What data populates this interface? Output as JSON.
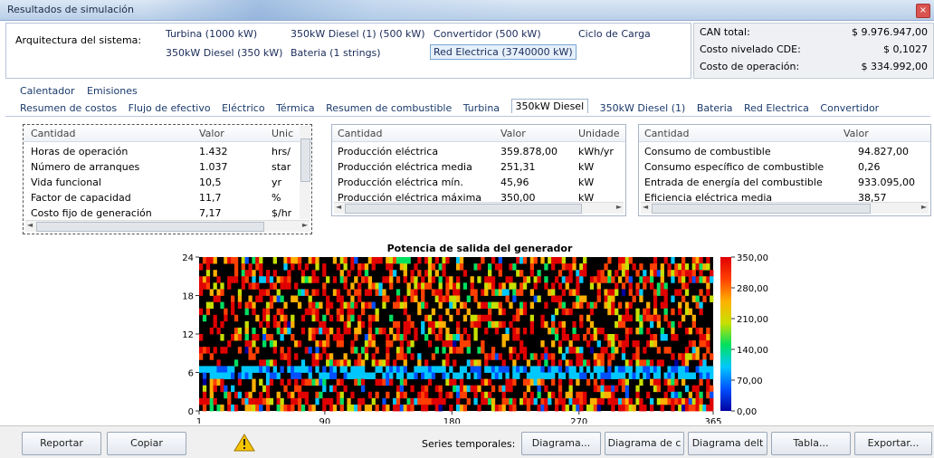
{
  "window": {
    "title": "Resultados de simulación",
    "close_glyph": "×"
  },
  "architecture": {
    "label": "Arquitectura del sistema:",
    "cells": [
      "Turbina (1000 kW)",
      "350kW Diesel (1) (500 kW)",
      "Convertidor (500 kW)",
      "Ciclo de Carga",
      "350kW Diesel (350 kW)",
      "Bateria (1 strings)",
      "Red Electrica (3740000 kW)"
    ]
  },
  "costs": [
    {
      "label": "CAN total:",
      "value": "$ 9.976.947,00"
    },
    {
      "label": "Costo nivelado CDE:",
      "value": "$ 0,1027"
    },
    {
      "label": "Costo de operación:",
      "value": "$ 334.992,00"
    }
  ],
  "tabs_row1": [
    "Calentador",
    "Emisiones"
  ],
  "tabs_row2": [
    "Resumen de costos",
    "Flujo de efectivo",
    "Eléctrico",
    "Térmica",
    "Resumen de combustible",
    "Turbina",
    "350kW Diesel",
    "350kW Diesel (1)",
    "Bateria",
    "Red Electrica",
    "Convertidor"
  ],
  "active_tab": "350kW Diesel",
  "table1": {
    "headers": [
      "Cantidad",
      "Valor",
      "Unic"
    ],
    "rows": [
      [
        "Horas de operación",
        "1.432",
        "hrs/"
      ],
      [
        "Número de arranques",
        "1.037",
        "star"
      ],
      [
        "Vida funcional",
        "10,5",
        "yr"
      ],
      [
        "Factor de capacidad",
        "11,7",
        "%"
      ],
      [
        "Costo fijo de generación",
        "7,17",
        "$/hr"
      ]
    ]
  },
  "table2": {
    "headers": [
      "Cantidad",
      "Valor",
      "Unidade"
    ],
    "rows": [
      [
        "Producción eléctrica",
        "359.878,00",
        "kWh/yr"
      ],
      [
        "Producción eléctrica media",
        "251,31",
        "kW"
      ],
      [
        "Producción eléctrica mín.",
        "45,96",
        "kW"
      ],
      [
        "Producción eléctrica máxima",
        "350,00",
        "kW"
      ]
    ]
  },
  "table3": {
    "headers": [
      "Cantidad",
      "Valor"
    ],
    "rows": [
      [
        "Consumo de combustible",
        "94.827,00"
      ],
      [
        "Consumo específico de combustible",
        "0,26"
      ],
      [
        "Entrada de energía del combustible",
        "933.095,00"
      ],
      [
        "Eficiencia eléctrica media",
        "38,57"
      ]
    ]
  },
  "chart_data": {
    "type": "heatmap",
    "title": "Potencia de salida del generador",
    "x_ticks": [
      "1",
      "90",
      "180",
      "270",
      "365"
    ],
    "y_ticks": [
      "0",
      "6",
      "12",
      "18",
      "24"
    ],
    "xlim": [
      1,
      365
    ],
    "ylim": [
      0,
      24
    ],
    "colorbar_ticks": [
      "0,00",
      "70,00",
      "140,00",
      "210,00",
      "280,00",
      "350,00"
    ],
    "colorbar_range": [
      0,
      350
    ],
    "colors": [
      "#0000a0",
      "#0050ff",
      "#00c8ff",
      "#00e060",
      "#c8e000",
      "#ffb000",
      "#ff4000",
      "#e00000"
    ]
  },
  "bottom": {
    "report": "Reportar",
    "copy": "Copiar",
    "series_label": "Series temporales:",
    "diagram": "Diagrama...",
    "diagram_c": "Diagrama de c",
    "diagram_delta": "Diagrama delt",
    "table": "Tabla...",
    "export": "Exportar..."
  }
}
